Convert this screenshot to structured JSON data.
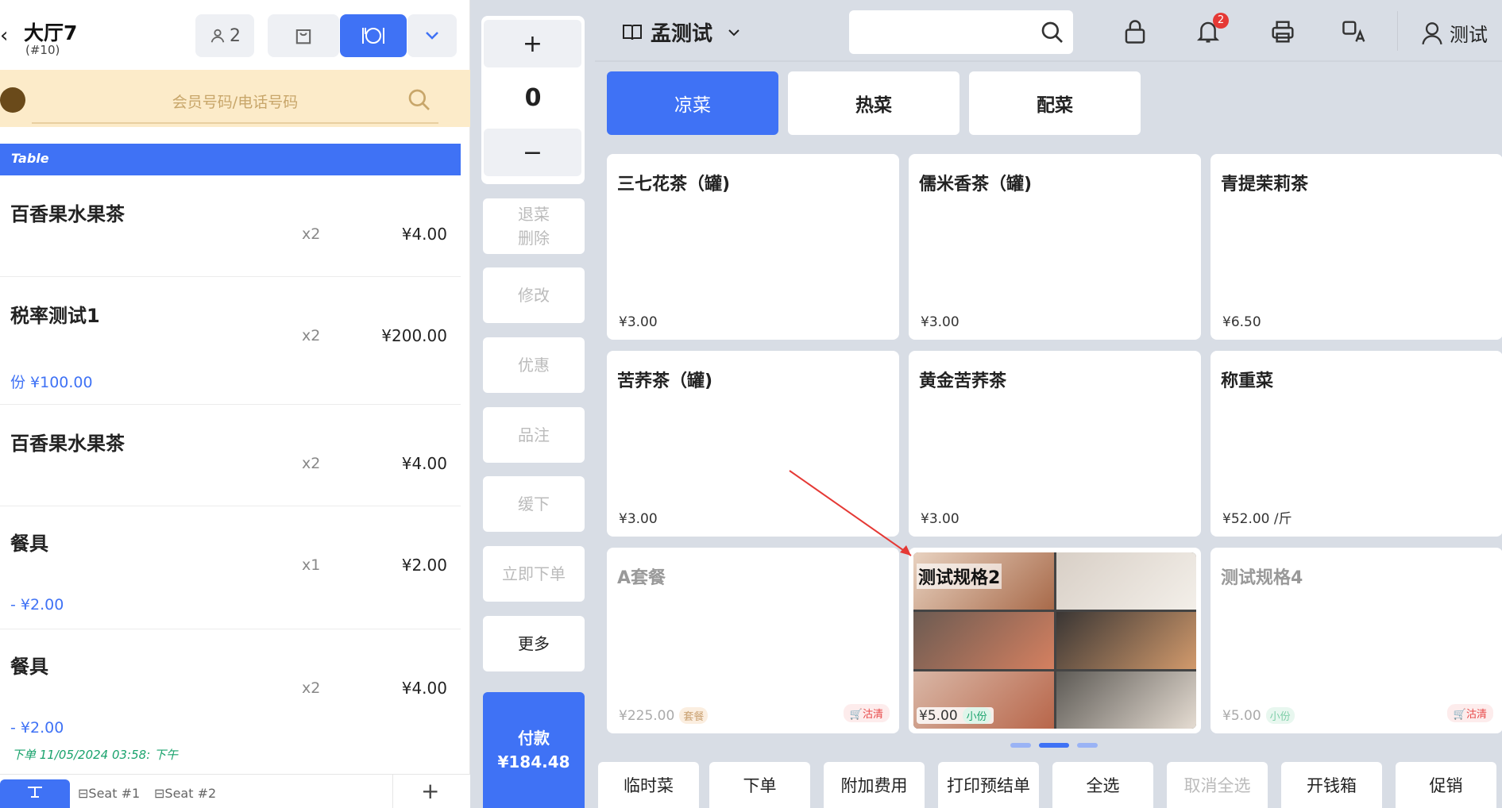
{
  "left": {
    "title": "大厅7",
    "order_no": "(#10)",
    "guests": "2",
    "member_placeholder": "会员号码/电话号码",
    "table_label": "Table",
    "items": [
      {
        "name": "百香果水果茶",
        "qty": "x2",
        "price": "¥4.00",
        "extra": ""
      },
      {
        "name": "税率测试1",
        "qty": "x2",
        "price": "¥200.00",
        "extra": "份 ¥100.00"
      },
      {
        "name": "百香果水果茶",
        "qty": "x2",
        "price": "¥4.00",
        "extra": ""
      },
      {
        "name": "餐具",
        "qty": "x1",
        "price": "¥2.00",
        "extra": "- ¥2.00"
      },
      {
        "name": "餐具",
        "qty": "x2",
        "price": "¥4.00",
        "extra": "- ¥2.00",
        "order_time": "下单 11/05/2024 03:58: 下午"
      }
    ],
    "seats": [
      "Seat #1",
      "Seat #2"
    ],
    "add_label": "+"
  },
  "mid": {
    "plus": "+",
    "count": "0",
    "minus": "−",
    "buttons": [
      "退菜\n删除",
      "修改",
      "优惠",
      "品注",
      "缓下",
      "立即下单",
      "更多"
    ],
    "pay_label": "付款",
    "pay_amount": "¥184.48"
  },
  "topbar": {
    "store_name": "孟测试",
    "notification_count": "2",
    "user_name": "测试"
  },
  "categories": [
    {
      "label": "凉菜",
      "active": true
    },
    {
      "label": "热菜",
      "active": false
    },
    {
      "label": "配菜",
      "active": false
    }
  ],
  "products": [
    {
      "name": "三七花茶（罐)",
      "price": "¥3.00"
    },
    {
      "name": "儒米香茶（罐)",
      "price": "¥3.00"
    },
    {
      "name": "青提茉莉茶",
      "price": "¥6.50"
    },
    {
      "name": "苦荞茶（罐)",
      "price": "¥3.00"
    },
    {
      "name": "黄金苦荞茶",
      "price": "¥3.00"
    },
    {
      "name": "称重菜",
      "price": "¥52.00 /斤"
    },
    {
      "name": "A套餐",
      "price": "¥225.00",
      "tag": "套餐",
      "soldout": "沽清"
    },
    {
      "name": "测试规格2",
      "price": "¥5.00",
      "tag": "小份"
    },
    {
      "name": "测试规格4",
      "price": "¥5.00",
      "tag": "小份",
      "soldout": "沽清"
    }
  ],
  "bottom_buttons": [
    "临时菜",
    "下单",
    "附加费用",
    "打印预结单",
    "全选",
    "取消全选",
    "开钱箱",
    "促销"
  ],
  "colors": {
    "accent": "#3f72f5",
    "member_bg": "#fcebc9",
    "green": "#1aa36d",
    "red": "#e84a4a"
  }
}
